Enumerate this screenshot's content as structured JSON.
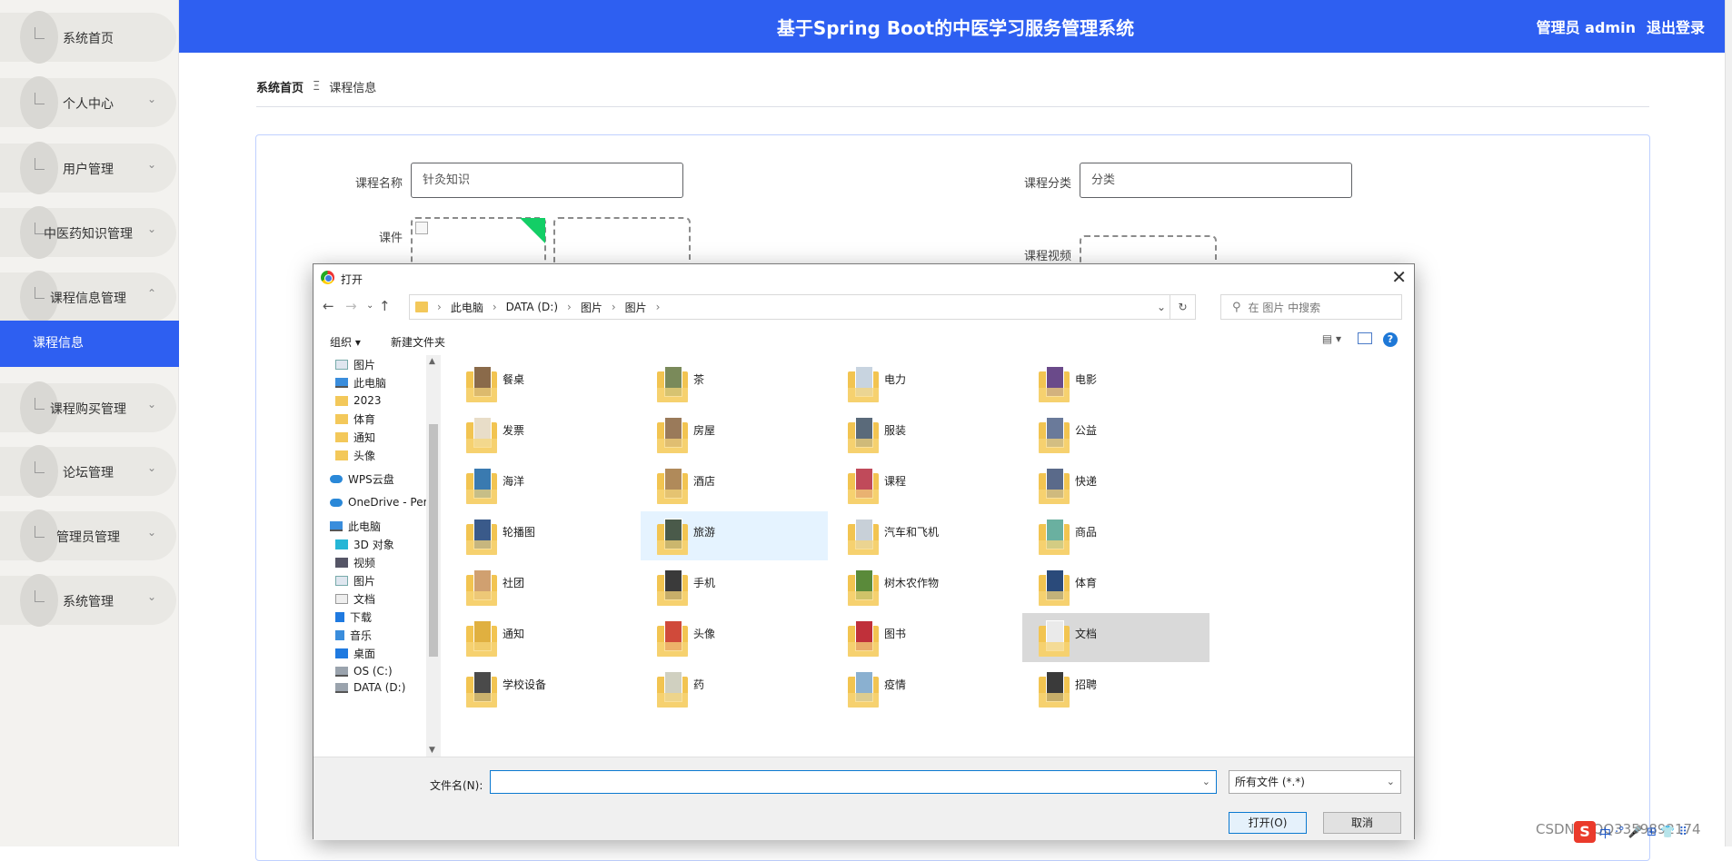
{
  "header": {
    "title": "基于Spring Boot的中医学习服务管理系统",
    "user_label": "管理员 admin",
    "logout": "退出登录"
  },
  "sidebar": {
    "items": [
      {
        "label": "系统首页",
        "chevron": ""
      },
      {
        "label": "个人中心",
        "chevron": "⌄"
      },
      {
        "label": "用户管理",
        "chevron": "⌄"
      },
      {
        "label": "中医药知识管理",
        "chevron": "⌄"
      },
      {
        "label": "课程信息管理",
        "chevron": "⌃"
      },
      {
        "label": "课程购买管理",
        "chevron": "⌄"
      },
      {
        "label": "论坛管理",
        "chevron": "⌄"
      },
      {
        "label": "管理员管理",
        "chevron": "⌄"
      },
      {
        "label": "系统管理",
        "chevron": "⌄"
      }
    ],
    "active_sub": "课程信息"
  },
  "breadcrumb": {
    "home": "系统首页",
    "sep": "Ξ",
    "current": "课程信息"
  },
  "form": {
    "course_name_label": "课程名称",
    "course_name_value": "针灸知识",
    "course_category_label": "课程分类",
    "course_category_value": "分类",
    "courseware_label": "课件",
    "video_label": "课程视频"
  },
  "dialog": {
    "title": "打开",
    "close": "✕",
    "nav": {
      "back": "←",
      "forward": "→",
      "recent": "⌄",
      "up": "↑"
    },
    "path": [
      "此电脑",
      "DATA (D:)",
      "图片",
      "图片"
    ],
    "path_sep": "›",
    "refresh": "↻",
    "dropdown": "⌄",
    "search_placeholder": "在 图片 中搜索",
    "toolbar": {
      "organize": "组织 ▾",
      "new_folder": "新建文件夹",
      "view": "▤ ▾",
      "help": "?"
    },
    "tree": [
      {
        "label": "图片",
        "icon": "pic",
        "pin": "📌"
      },
      {
        "label": "此电脑",
        "icon": "pc",
        "pin": "📌"
      },
      {
        "label": "2023",
        "icon": "fold"
      },
      {
        "label": "体育",
        "icon": "fold"
      },
      {
        "label": "通知",
        "icon": "fold"
      },
      {
        "label": "头像",
        "icon": "fold"
      },
      {
        "label": "WPS云盘",
        "icon": "cloud"
      },
      {
        "label": "OneDrive - Perso",
        "icon": "cloud"
      },
      {
        "label": "此电脑",
        "icon": "pc"
      },
      {
        "label": "3D 对象",
        "icon": "d3"
      },
      {
        "label": "视频",
        "icon": "vid"
      },
      {
        "label": "图片",
        "icon": "pic"
      },
      {
        "label": "文档",
        "icon": "doc"
      },
      {
        "label": "下载",
        "icon": "dl"
      },
      {
        "label": "音乐",
        "icon": "mus"
      },
      {
        "label": "桌面",
        "icon": "desk"
      },
      {
        "label": "OS (C:)",
        "icon": "drv"
      },
      {
        "label": "DATA (D:)",
        "icon": "drv"
      }
    ],
    "folders": [
      {
        "name": "餐桌",
        "color": "#8a6a4a"
      },
      {
        "name": "茶",
        "color": "#7a8a5a"
      },
      {
        "name": "电力",
        "color": "#c8d4e0"
      },
      {
        "name": "电影",
        "color": "#6a4a8a"
      },
      {
        "name": "发票",
        "color": "#e8ddc8"
      },
      {
        "name": "房屋",
        "color": "#9a7a5a"
      },
      {
        "name": "服装",
        "color": "#5a6a7a"
      },
      {
        "name": "公益",
        "color": "#6a7a9a"
      },
      {
        "name": "海洋",
        "color": "#3a7ab0"
      },
      {
        "name": "酒店",
        "color": "#b08a5a"
      },
      {
        "name": "课程",
        "color": "#c04a5a"
      },
      {
        "name": "快递",
        "color": "#5a6a8a"
      },
      {
        "name": "轮播图",
        "color": "#3a5a8a"
      },
      {
        "name": "旅游",
        "color": "#4a5a4a"
      },
      {
        "name": "汽车和飞机",
        "color": "#c8d0d8"
      },
      {
        "name": "商品",
        "color": "#6ab0a0"
      },
      {
        "name": "社团",
        "color": "#d0a070"
      },
      {
        "name": "手机",
        "color": "#3a3a3a"
      },
      {
        "name": "树木农作物",
        "color": "#5a8a3a"
      },
      {
        "name": "体育",
        "color": "#2a4a7a"
      },
      {
        "name": "通知",
        "color": "#e0b040"
      },
      {
        "name": "头像",
        "color": "#d04a3a"
      },
      {
        "name": "图书",
        "color": "#c0303a"
      },
      {
        "name": "文档",
        "color": "#eaeaea"
      },
      {
        "name": "学校设备",
        "color": "#4a4a4a"
      },
      {
        "name": "药",
        "color": "#d0d0c0"
      },
      {
        "name": "疫情",
        "color": "#8ab0d0"
      },
      {
        "name": "招聘",
        "color": "#3a3a3a"
      }
    ],
    "hovered": "旅游",
    "selected": "文档",
    "filename_label": "文件名(N):",
    "filename_value": "",
    "filetype": "所有文件 (*.*)",
    "open_button": "打开(O)",
    "cancel_button": "取消"
  },
  "watermark": "CSDN @QQ3359892174",
  "tray": {
    "logo": "S",
    "lang": "中",
    "items": "·° 🎤 ⊞ 👕 ⠿"
  },
  "colors": {
    "brand": "#2e5ff1",
    "upload_corner": "#13ce66",
    "folder": "#f2c451"
  }
}
